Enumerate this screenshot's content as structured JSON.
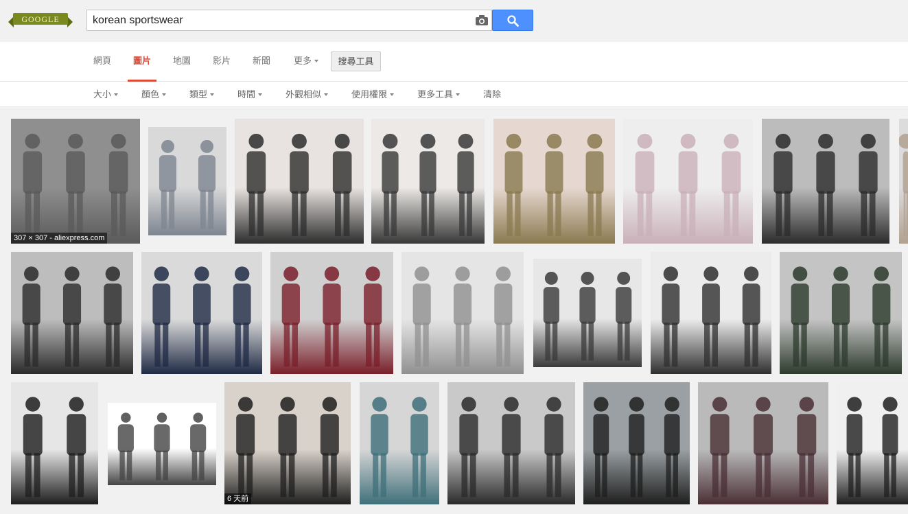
{
  "header": {
    "logo_text": "GOOGLE",
    "search_value": "korean sportswear",
    "camera_icon": "camera-icon",
    "search_icon": "search-icon"
  },
  "tabs": [
    {
      "label": "網頁",
      "active": false
    },
    {
      "label": "圖片",
      "active": true
    },
    {
      "label": "地圖",
      "active": false
    },
    {
      "label": "影片",
      "active": false
    },
    {
      "label": "新聞",
      "active": false
    },
    {
      "label": "更多",
      "active": false,
      "dropdown": true
    }
  ],
  "search_tools_label": "搜尋工具",
  "filters": [
    {
      "label": "大小",
      "dropdown": true
    },
    {
      "label": "顏色",
      "dropdown": true
    },
    {
      "label": "類型",
      "dropdown": true
    },
    {
      "label": "時間",
      "dropdown": true
    },
    {
      "label": "外觀相似",
      "dropdown": true
    },
    {
      "label": "使用權限",
      "dropdown": true
    },
    {
      "label": "更多工具",
      "dropdown": true
    },
    {
      "label": "清除",
      "dropdown": false
    }
  ],
  "colors": {
    "accent_red": "#dd4b39",
    "search_blue": "#4d90fe",
    "logo_green": "#7b8a1f",
    "grid_bg": "#f1f1f1"
  },
  "results": [
    {
      "caption": "307 × 307 - aliexpress.com"
    },
    {
      "caption": ""
    },
    {
      "caption": ""
    },
    {
      "caption": ""
    },
    {
      "caption": ""
    },
    {
      "caption": ""
    },
    {
      "caption": ""
    },
    {
      "caption": ""
    },
    {
      "caption": ""
    },
    {
      "caption": ""
    },
    {
      "caption": ""
    },
    {
      "caption": ""
    },
    {
      "caption": ""
    },
    {
      "caption": ""
    },
    {
      "caption": ""
    },
    {
      "caption": ""
    },
    {
      "caption": ""
    },
    {
      "caption": "6 天前"
    },
    {
      "caption": ""
    },
    {
      "caption": ""
    },
    {
      "caption": ""
    },
    {
      "caption": ""
    },
    {
      "caption": ""
    },
    {
      "caption": ""
    }
  ]
}
